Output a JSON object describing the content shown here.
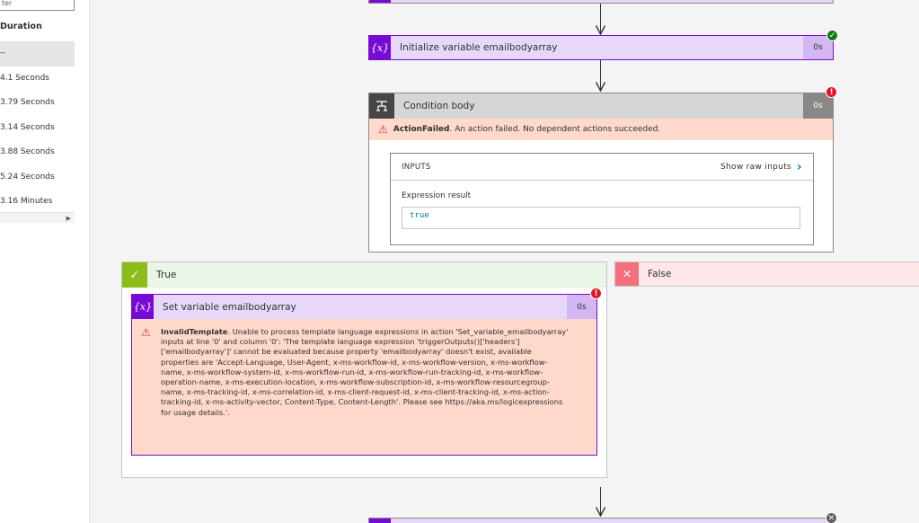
{
  "left_panel": {
    "filter_placeholder": "ter",
    "duration_header": "Duration",
    "rows": [
      "--",
      "4.1 Seconds",
      "3.79 Seconds",
      "3.14 Seconds",
      "3.88 Seconds",
      "5.24 Seconds",
      "3.16 Minutes"
    ]
  },
  "init_variable": {
    "icon": "{x}",
    "title": "Initialize variable emailbodyarray",
    "duration": "0s",
    "status": "succeeded"
  },
  "condition": {
    "title": "Condition body",
    "duration": "0s",
    "status": "failed",
    "error_code": "ActionFailed",
    "error_message": ". An action failed. No dependent actions succeeded.",
    "inputs_label": "INPUTS",
    "show_raw_label": "Show raw inputs",
    "expression_label": "Expression result",
    "expression_value": "true"
  },
  "true_branch": {
    "label": "True",
    "set_variable": {
      "icon": "{x}",
      "title": "Set variable emailbodyarray",
      "duration": "0s",
      "status": "failed",
      "error_code": "InvalidTemplate",
      "error_message": ". Unable to process template language expressions in action 'Set_variable_emailbodyarray' inputs at line '0' and column '0': 'The template language expression 'triggerOutputs()['headers']['emailbodyarray']' cannot be evaluated because property 'emailbodyarray' doesn't exist, available properties are 'Accept-Language, User-Agent, x-ms-workflow-id, x-ms-workflow-version, x-ms-workflow-name, x-ms-workflow-system-id, x-ms-workflow-run-id, x-ms-workflow-run-tracking-id, x-ms-workflow-operation-name, x-ms-execution-location, x-ms-workflow-subscription-id, x-ms-workflow-resourcegroup-name, x-ms-tracking-id, x-ms-correlation-id, x-ms-client-request-id, x-ms-client-tracking-id, x-ms-action-tracking-id, x-ms-activity-vector, Content-Type, Content-Length'. Please see https://aka.ms/logicexpressions for usage details.'."
    }
  },
  "false_branch": {
    "label": "False"
  },
  "colors": {
    "variable_purple": "#770bd6",
    "variable_light": "#e7d8f9",
    "success": "#107c10",
    "error": "#e81123",
    "error_bg": "#fed9cc",
    "true_green": "#8cbd18",
    "false_red": "#f1707b",
    "link_blue": "#0078d4"
  }
}
